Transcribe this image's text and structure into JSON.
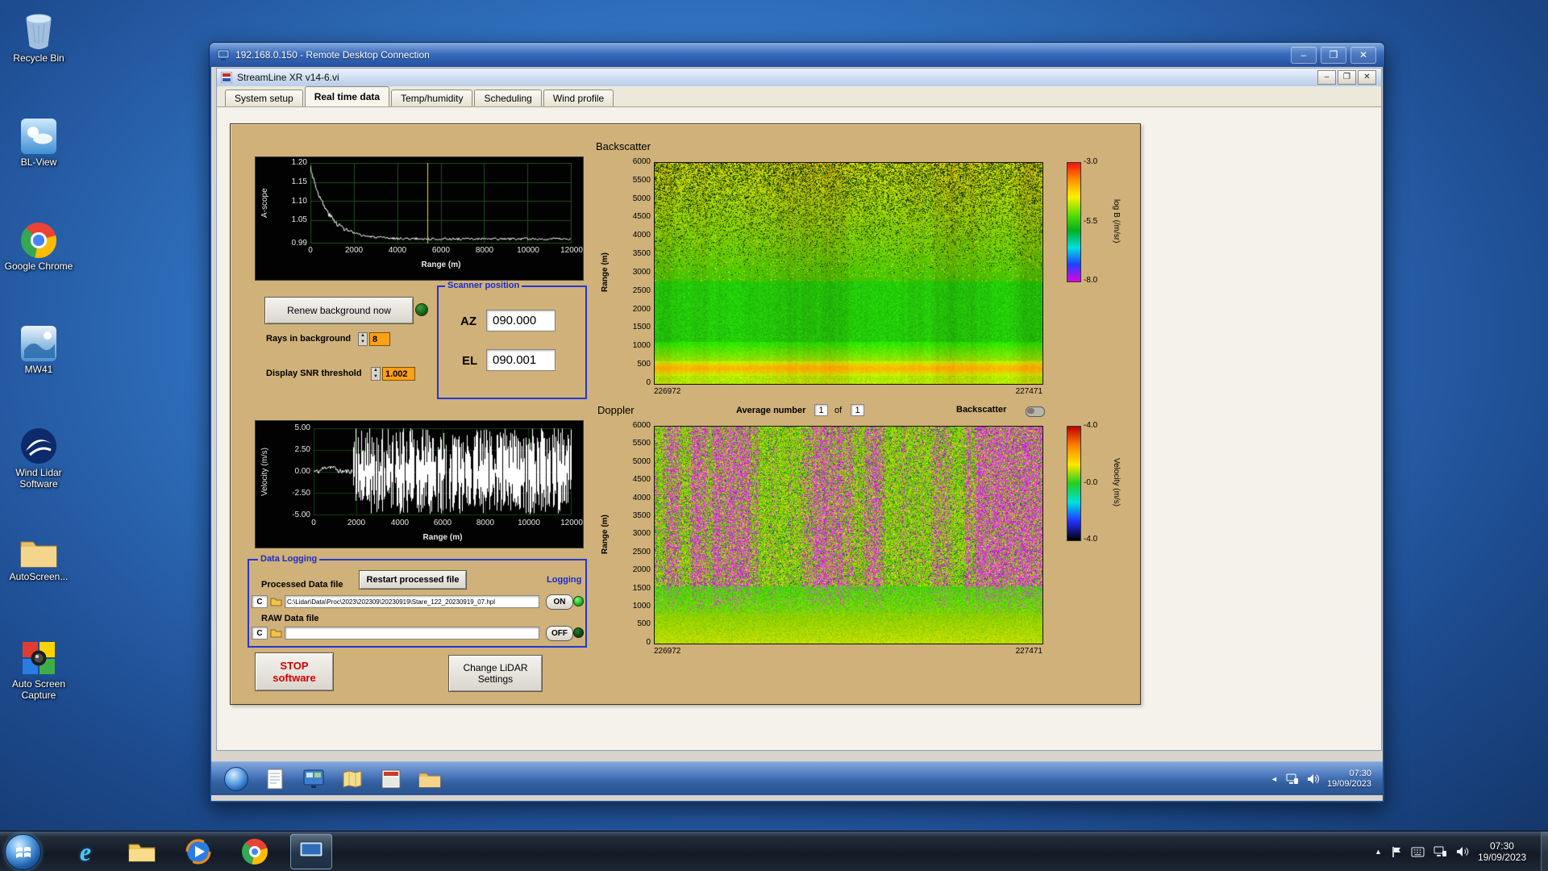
{
  "desktop": {
    "icons": [
      {
        "id": "recycle-bin",
        "label": "Recycle Bin"
      },
      {
        "id": "bl-view",
        "label": "BL-View"
      },
      {
        "id": "google-chrome",
        "label": "Google Chrome"
      },
      {
        "id": "mw41",
        "label": "MW41"
      },
      {
        "id": "wind-lidar-software",
        "label": "Wind Lidar Software"
      },
      {
        "id": "autoscreen",
        "label": "AutoScreen..."
      },
      {
        "id": "auto-screen-capture",
        "label": "Auto Screen Capture"
      }
    ]
  },
  "rdp": {
    "title": "192.168.0.150 - Remote Desktop Connection",
    "buttons": {
      "minimize": "–",
      "maximize": "❐",
      "close": "✕"
    }
  },
  "app": {
    "title": "StreamLine XR v14-6.vi",
    "tabs": [
      "System setup",
      "Real time data",
      "Temp/humidity",
      "Scheduling",
      "Wind profile"
    ],
    "active_tab": "Real time data",
    "buttons": {
      "minimize": "–",
      "restore": "❐",
      "close": "✕"
    }
  },
  "panel": {
    "backscatter_title": "Backscatter",
    "doppler_title": "Doppler",
    "renew_button": "Renew background now",
    "rays_label": "Rays in background",
    "rays_value": "8",
    "snr_label": "Display SNR threshold",
    "snr_value": "1.002",
    "scanner": {
      "title": "Scanner position",
      "az_label": "AZ",
      "az_value": "090.000",
      "el_label": "EL",
      "el_value": "090.001"
    },
    "average": {
      "label": "Average number",
      "value": "1",
      "of_label": "of",
      "total": "1"
    },
    "backscatter_toggle_label": "Backscatter",
    "logging": {
      "title": "Data Logging",
      "processed_label": "Processed Data file",
      "restart_button": "Restart processed file",
      "logging_label": "Logging",
      "drive": "C",
      "processed_path": "C:\\Lidar\\Data\\Proc\\2023\\202309\\20230919\\Stare_122_20230919_07.hpl",
      "on_label": "ON",
      "raw_label": "RAW Data file",
      "raw_path": "",
      "off_label": "OFF"
    },
    "stop_button_line1": "STOP",
    "stop_button_line2": "software",
    "settings_button_line1": "Change LiDAR",
    "settings_button_line2": "Settings"
  },
  "remote_taskbar": {
    "time": "07:30",
    "date": "19/09/2023",
    "icons": [
      "start-orb",
      "notepad",
      "system-app",
      "map-app",
      "streamline-app",
      "file-explorer"
    ]
  },
  "host_taskbar": {
    "time": "07:30",
    "date": "19/09/2023",
    "icons": [
      "start-orb",
      "internet-explorer",
      "windows-explorer",
      "windows-media-player",
      "google-chrome",
      "remote-desktop"
    ],
    "tray_icons": [
      "hidden-icons-arrow",
      "action-center-flag",
      "input-indicator",
      "network",
      "volume"
    ]
  },
  "chart_data": [
    {
      "id": "ascope",
      "type": "line",
      "ylabel": "A-scope",
      "xlabel": "Range (m)",
      "xlim": [
        0,
        12000
      ],
      "ylim": [
        0.99,
        1.2
      ],
      "xticks": [
        "0",
        "2000",
        "4000",
        "6000",
        "8000",
        "10000",
        "12000"
      ],
      "xtick_values": [
        0,
        2000,
        4000,
        6000,
        8000,
        10000,
        12000
      ],
      "yticks": [
        "1.20",
        "1.15",
        "1.10",
        "1.05",
        "0.99"
      ],
      "ytick_values": [
        1.2,
        1.15,
        1.1,
        1.05,
        0.99
      ],
      "cursor_x": 5400,
      "decay": 800,
      "noise_amp": 0.006,
      "series_desc": "background A-scope trace: starts ~1.19 at range 0, exponential decay to ~1.00 by 2500 m, flat noisy ~1.00 out to 12000 m; yellow cursor line at ~5400 m",
      "colors": {
        "bg": "#020202",
        "grid": "#1e4d1e",
        "line": "#ffffff",
        "cursor": "#ffd400"
      }
    },
    {
      "id": "velocity",
      "type": "line",
      "ylabel": "Velocity (m/s)",
      "xlabel": "Range (m)",
      "xlim": [
        0,
        12000
      ],
      "ylim": [
        -5,
        5
      ],
      "xticks": [
        "0",
        "2000",
        "4000",
        "6000",
        "8000",
        "10000",
        "12000"
      ],
      "xtick_values": [
        0,
        2000,
        4000,
        6000,
        8000,
        10000,
        12000
      ],
      "yticks": [
        "5.00",
        "2.50",
        "0.00",
        "-2.50",
        "-5.00"
      ],
      "ytick_values": [
        5,
        2.5,
        0,
        -2.5,
        -5
      ],
      "calm_until_x": 1800,
      "series_desc": "radial velocity ~0 m/s with small noise below ~1800 m; saturated random +/-5 m/s noise spikes from 1800 m to 12000 m",
      "colors": {
        "bg": "#020202",
        "grid": "#173d17",
        "line": "#ffffff"
      }
    },
    {
      "id": "backscatter",
      "type": "heatmap",
      "title": "Backscatter",
      "ylabel": "Range (m)",
      "ylim": [
        0,
        6000
      ],
      "yticks": [
        "6000",
        "5500",
        "5000",
        "4500",
        "4000",
        "3500",
        "3000",
        "2500",
        "2000",
        "1500",
        "1000",
        "500",
        "0"
      ],
      "x_start_label": "226972",
      "x_end_label": "227471",
      "colorbar": {
        "label": "log B (/m/sr)",
        "ticks": [
          "-3.0",
          "-5.5",
          "-8.0"
        ],
        "gradient": [
          "#ff1010",
          "#ff9000",
          "#fff000",
          "#60e000",
          "#00b020",
          "#00e0e0",
          "#2040ff",
          "#e000e0"
        ]
      },
      "features": {
        "bright_aerosol_band_m": [
          250,
          600
        ],
        "smooth_green_m": [
          600,
          2800
        ],
        "speckled_noise_above_m": 2800,
        "description": "bright yellow-orange aerosol band below ~600 m, smooth green 600-2800 m, increasingly speckled yellow-green noise up to 6000 m"
      }
    },
    {
      "id": "doppler",
      "type": "heatmap",
      "title": "Doppler",
      "ylabel": "Range (m)",
      "ylim": [
        0,
        6000
      ],
      "yticks": [
        "6000",
        "5500",
        "5000",
        "4500",
        "4000",
        "3500",
        "3000",
        "2500",
        "2000",
        "1500",
        "1000",
        "500",
        "0"
      ],
      "x_start_label": "226972",
      "x_end_label": "227471",
      "colorbar": {
        "label": "Velocity (m/s)",
        "ticks": [
          "-4.0",
          "-0.0",
          "-4.0"
        ],
        "gradient": [
          "#c00000",
          "#ff8000",
          "#ffe800",
          "#20d020",
          "#00e0e0",
          "#2030ff",
          "#000000"
        ]
      },
      "features": {
        "aerosol_layer_below_m": 1500,
        "magenta_noise_streaks_above_m": 1500,
        "description": "smooth yellow-green aerosol layer below ~1500 m; dense vertical magenta noise streaks over green/yellow speckle above"
      }
    }
  ]
}
